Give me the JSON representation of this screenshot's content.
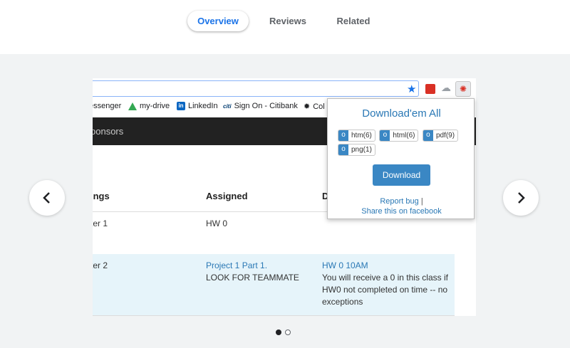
{
  "tabs": {
    "overview": "Overview",
    "reviews": "Reviews",
    "related": "Related"
  },
  "carousel": {
    "prev_icon": "chevron-left-icon",
    "next_icon": "chevron-right-icon",
    "active_slide": 1,
    "total_slides": 2
  },
  "screenshot": {
    "bookmarks": {
      "messenger": "essenger",
      "drive": "my-drive",
      "linkedin": "LinkedIn",
      "linkedin_badge": "in",
      "citi_badge": "citi",
      "citi": "Sign On - Citibank",
      "col": "Col"
    },
    "nav_text": "ponsors",
    "table": {
      "headers": [
        "ings",
        "Assigned",
        "D"
      ],
      "row1": {
        "reading": "ter 1",
        "assigned": "HW 0"
      },
      "row2": {
        "reading": "ter 2",
        "assigned_link": "Project 1 Part 1.",
        "assigned_text": "LOOK FOR TEAMMATE",
        "due_link": "HW 0 10AM",
        "due_text": "You will receive a 0 in this class if HW0 not completed on time -- no exceptions"
      }
    }
  },
  "popup": {
    "title": "Download'em All",
    "chips": [
      {
        "o": "o",
        "label": "htm(6)"
      },
      {
        "o": "o",
        "label": "html(6)"
      },
      {
        "o": "o",
        "label": "pdf(9)"
      },
      {
        "o": "o",
        "label": "png(1)"
      }
    ],
    "download_label": "Download",
    "report_label": "Report bug",
    "separator": "|",
    "share_label": "Share this on facebook"
  },
  "colors": {
    "accent": "#1a73e8",
    "popup_link": "#2a78b5",
    "button": "#3a87c4",
    "highlight_row": "#e6f4fa"
  }
}
